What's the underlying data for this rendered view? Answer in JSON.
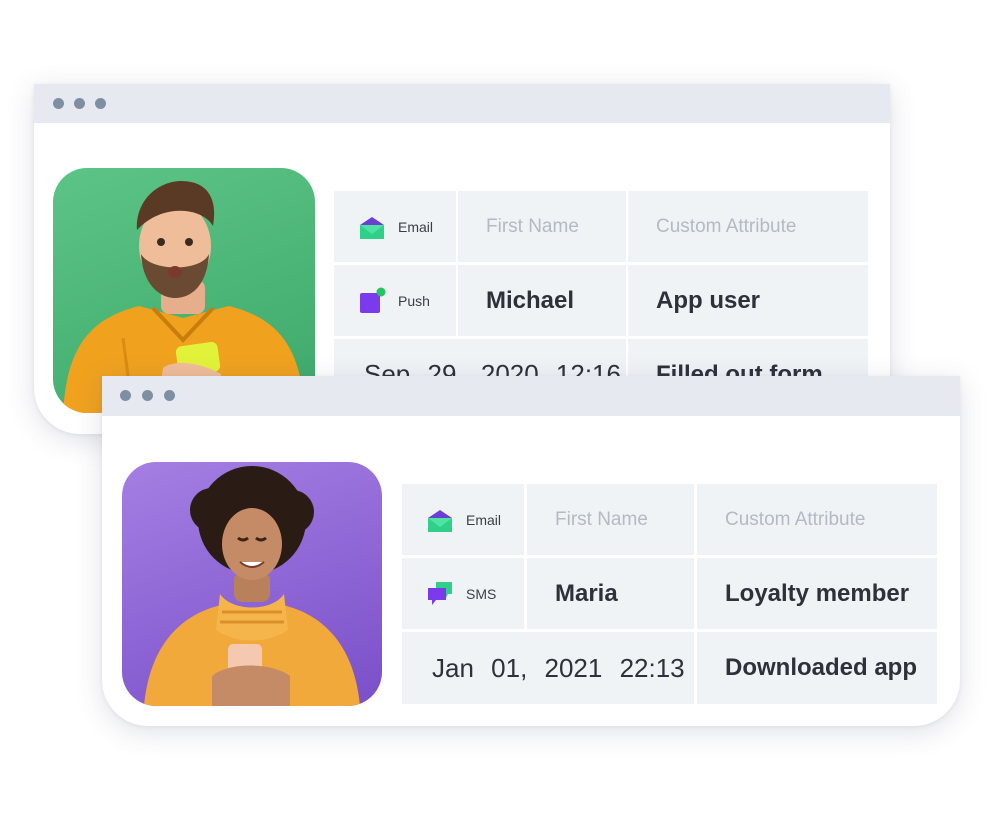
{
  "cards": [
    {
      "person": "man",
      "rows": [
        {
          "channel": {
            "icon": "email-icon",
            "label": "Email"
          },
          "first_name": "First Name",
          "custom_attribute": "Custom Attribute",
          "placeholder": true
        },
        {
          "channel": {
            "icon": "push-icon",
            "label": "Push"
          },
          "first_name": "Michael",
          "custom_attribute": "App user"
        },
        {
          "datetime": "Sep 29, 2020  12:16",
          "custom_attribute": "Filled out form"
        }
      ]
    },
    {
      "person": "woman",
      "rows": [
        {
          "channel": {
            "icon": "email-icon",
            "label": "Email"
          },
          "first_name": "First Name",
          "custom_attribute": "Custom Attribute",
          "placeholder": true
        },
        {
          "channel": {
            "icon": "sms-icon",
            "label": "SMS"
          },
          "first_name": "Maria",
          "custom_attribute": "Loyalty member"
        },
        {
          "datetime": "Jan 01, 2021  22:13",
          "custom_attribute": "Downloaded app"
        }
      ]
    }
  ],
  "colors": {
    "titlebar": "#e6eaf0",
    "window_dot": "#7f8fa3",
    "cell_bg": "#f0f3f6",
    "email_icon_purple": "#6b3fd6",
    "email_icon_green": "#2fd18a",
    "push_icon_purple": "#7c3aed",
    "push_dot_green": "#22c55e",
    "sms_icon_purple": "#7c3aed",
    "sms_icon_green": "#2fd18a",
    "photo_green": "#4fb878",
    "photo_purple": "#8e62d6"
  }
}
